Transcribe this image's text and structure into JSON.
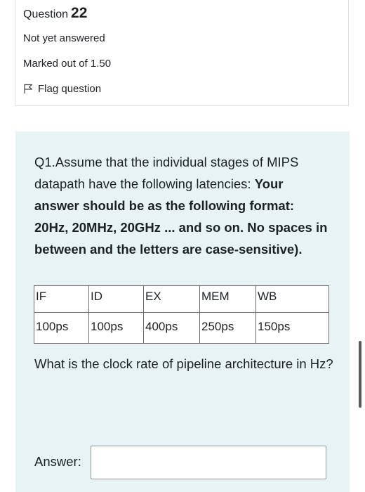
{
  "info": {
    "question_label": "Question",
    "question_number": "22",
    "state": "Not yet answered",
    "grade": "Marked out of 1.50",
    "flag_label": "Flag question"
  },
  "question": {
    "intro": "Q1.Assume that the individual stages of MIPS datapath have the following latencies:",
    "instruction": "Your answer should be as the following format: 20Hz, 20MHz, 20GHz ... and so on. No spaces in between and the letters are case-sensitive).",
    "table": {
      "headers": [
        "IF",
        "ID",
        "EX",
        "MEM",
        "WB"
      ],
      "values": [
        "100ps",
        "100ps",
        "400ps",
        "250ps",
        "150ps"
      ]
    },
    "followup": "What is the clock rate of pipeline architecture in Hz?",
    "answer_label": "Answer:",
    "answer_value": ""
  },
  "colors": {
    "content_background": "#e7f3f5",
    "border": "#dee2e6",
    "text": "#1d2125"
  },
  "icons": {
    "flag": "flag-outline-icon"
  }
}
